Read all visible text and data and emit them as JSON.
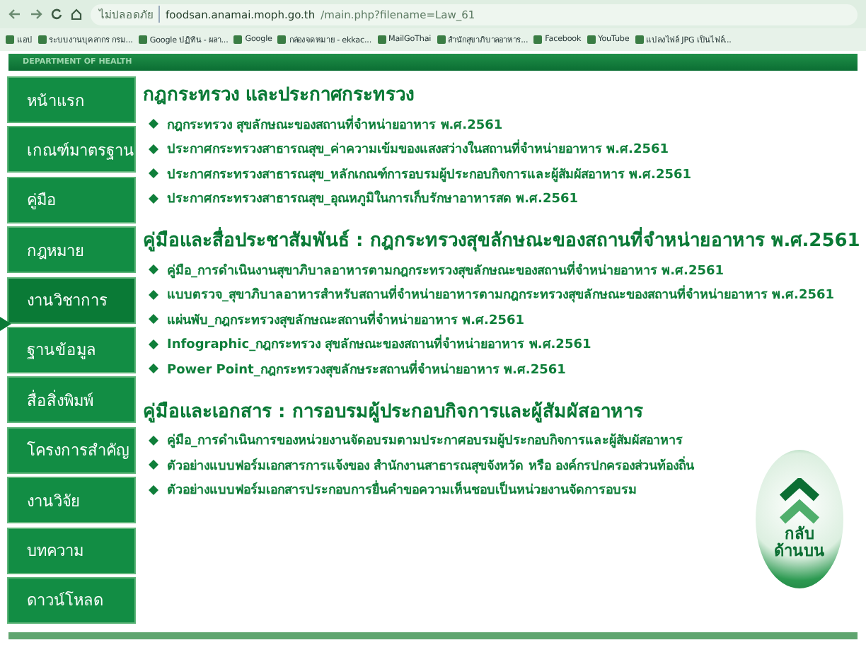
{
  "browser": {
    "security": "ไม่ปลอดภัย",
    "url_host": "foodsan.anamai.moph.go.th",
    "url_path": "/main.php?filename=Law_61"
  },
  "bookmarks": [
    "แอป",
    "ระบบงานบุคลากร กรม...",
    "Google ปฏิทิน - ผลา...",
    "Google",
    "กล่องจดหมาย - ekkac...",
    "MailGoThai",
    "สำนักสุขาภิบาลอาหาร...",
    "Facebook",
    "YouTube",
    "แปลงไฟล์ JPG เป็นไฟล์..."
  ],
  "header": {
    "title": "DEPARTMENT OF HEALTH"
  },
  "sidebar": {
    "items": [
      {
        "label": "หน้าแรก",
        "selected": false
      },
      {
        "label": "เกณฑ์มาตรฐาน",
        "selected": false
      },
      {
        "label": "คู่มือ",
        "selected": false
      },
      {
        "label": "กฎหมาย",
        "selected": false
      },
      {
        "label": "งานวิชาการ",
        "selected": true
      },
      {
        "label": "ฐานข้อมูล",
        "selected": false
      },
      {
        "label": "สื่อสิ่งพิมพ์",
        "selected": false
      },
      {
        "label": "โครงการสำคัญ",
        "selected": false
      },
      {
        "label": "งานวิจัย",
        "selected": false
      },
      {
        "label": "บทความ",
        "selected": false
      },
      {
        "label": "ดาวน์โหลด",
        "selected": false
      }
    ]
  },
  "sections": [
    {
      "title": "กฎกระทรวง และประกาศกระทรวง",
      "links": [
        "กฎกระทรวง สุขลักษณะของสถานที่จำหน่ายอาหาร พ.ศ.2561",
        "ประกาศกระทรวงสาธารณสุข_ค่าความเข้มของแสงสว่างในสถานที่จำหน่ายอาหาร พ.ศ.2561",
        "ประกาศกระทรวงสาธารณสุข_หลักเกณฑ์การอบรมผู้ประกอบกิจการและผู้สัมผัสอาหาร พ.ศ.2561",
        "ประกาศกระทรวงสาธารณสุข_อุณหภูมิในการเก็บรักษาอาหารสด พ.ศ.2561"
      ]
    },
    {
      "title": "คู่มือและสื่อประชาสัมพันธ์ : กฎกระทรวงสุขลักษณะของสถานที่จำหน่ายอาหาร พ.ศ.2561",
      "links": [
        "คู่มือ_การดำเนินงานสุขาภิบาลอาหารตามกฎกระทรวงสุขลักษณะของสถานที่จำหน่ายอาหาร พ.ศ.2561",
        "แบบตรวจ_สุขาภิบาลอาหารสำหรับสถานที่จำหน่ายอาหารตามกฎกระทรวงสุขลักษณะของสถานที่จำหน่ายอาหาร พ.ศ.2561",
        "แผ่นพับ_กฎกระทรวงสุขลักษณะสถานที่จำหน่ายอาหาร พ.ศ.2561",
        "Infographic_กฎกระทรวง สุขลักษณะของสถานที่จำหน่ายอาหาร พ.ศ.2561",
        "Power Point_กฎกระทรวงสุขลักษระสถานที่จำหน่ายอาหาร พ.ศ.2561"
      ]
    },
    {
      "title": "คู่มือและเอกสาร : การอบรมผู้ประกอบกิจการและผู้สัมผัสอาหาร",
      "links": [
        "คู่มือ_การดำเนินการของหน่วยงานจัดอบรมตามประกาศอบรมผู้ประกอบกิจการและผู้สัมผัสอาหาร",
        "ตัวอย่างแบบฟอร์มเอกสารการแจ้งของ สำนักงานสาธารณสุขจังหวัด หรือ องค์กรปกครองส่วนท้องถิ่น",
        "ตัวอย่างแบบฟอร์มเอกสารประกอบการยื่นคำขอความเห็นชอบเป็นหน่วยงานจัดการอบรม"
      ]
    }
  ],
  "back_to_top": {
    "label_lines": [
      "กลับ",
      "ด้านบน"
    ]
  }
}
